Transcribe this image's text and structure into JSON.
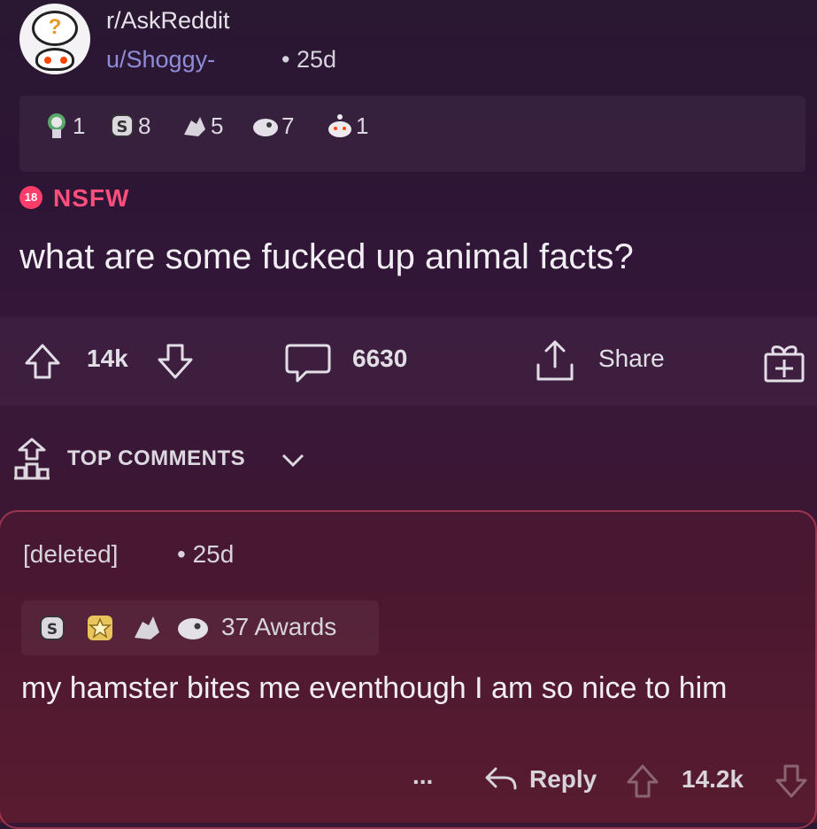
{
  "post": {
    "subreddit": "r/AskReddit",
    "author": "u/Shoggy-",
    "age": "• 25d",
    "awards": [
      {
        "icon": "gold-medal-icon",
        "count": "1"
      },
      {
        "icon": "silver-coin-icon",
        "count": "8"
      },
      {
        "icon": "wholesome-hands-icon",
        "count": "5"
      },
      {
        "icon": "face-award-icon",
        "count": "7"
      },
      {
        "icon": "snoo-award-icon",
        "count": "1"
      }
    ],
    "nsfw_badge": "18",
    "nsfw_label": "NSFW",
    "title": "what are some fucked up animal facts?",
    "upvotes": "14k",
    "comments": "6630",
    "share": "Share"
  },
  "sort": {
    "label": "TOP COMMENTS"
  },
  "comment": {
    "author": "[deleted]",
    "age": "• 25d",
    "awards_label": "37 Awards",
    "award_icons": [
      "silver-coin-icon",
      "star-award-icon",
      "wholesome-hands-icon",
      "face-award-icon"
    ],
    "body": "my hamster bites me eventhough I am so nice to him",
    "more": "...",
    "reply": "Reply",
    "score": "14.2k"
  },
  "colors": {
    "nsfw": "#ff4f7d",
    "username": "#8f8dd8",
    "accent_border": "#ff5a78"
  }
}
